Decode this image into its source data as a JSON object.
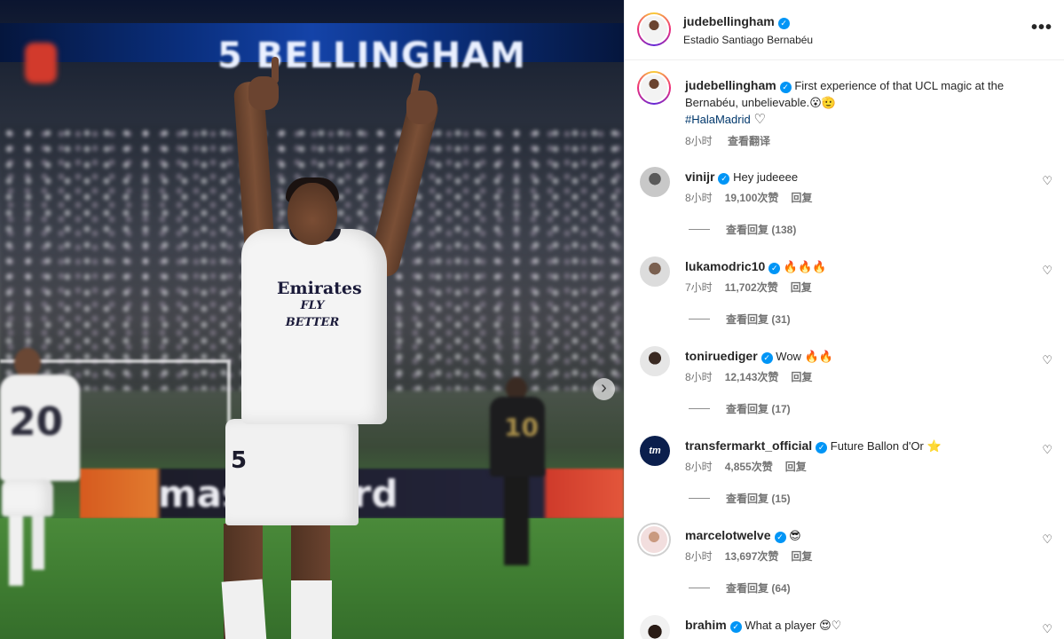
{
  "photo": {
    "banner_text": "5 BELLINGHAM",
    "shirt_sponsor_top": "Emirates",
    "shirt_sponsor_bottom": "FLY BETTER",
    "shorts_number": "5",
    "ad_board_text": "mastercard",
    "left_player_number": "20",
    "right_player_number": "10",
    "next_icon": "chevron-right-icon"
  },
  "header": {
    "username": "judebellingham",
    "location": "Estadio Santiago Bernabéu",
    "more_icon": "more-horizontal-icon",
    "more_label": "•••"
  },
  "caption": {
    "username": "judebellingham",
    "text": "First experience of that UCL magic at the Bernabéu, unbelievable.😮🫡",
    "hashtag": "#HalaMadrid",
    "heart": "♡",
    "time": "8小时",
    "translate": "查看翻译"
  },
  "comments": [
    {
      "username": "vinijr",
      "text": "Hey judeeee",
      "time": "8小时",
      "likes": "19,100次赞",
      "reply": "回复",
      "view_replies": "查看回复 (138)"
    },
    {
      "username": "lukamodric10",
      "text": "🔥🔥🔥",
      "time": "7小时",
      "likes": "11,702次赞",
      "reply": "回复",
      "view_replies": "查看回复 (31)"
    },
    {
      "username": "toniruediger",
      "text": "Wow 🔥🔥",
      "time": "8小时",
      "likes": "12,143次赞",
      "reply": "回复",
      "view_replies": "查看回复 (17)"
    },
    {
      "username": "transfermarkt_official",
      "text": "Future Ballon d'Or ⭐",
      "time": "8小时",
      "likes": "4,855次赞",
      "reply": "回复",
      "view_replies": "查看回复 (15)"
    },
    {
      "username": "marcelotwelve",
      "text": "😎",
      "time": "8小时",
      "likes": "13,697次赞",
      "reply": "回复",
      "view_replies": "查看回复 (64)"
    },
    {
      "username": "brahim",
      "text": "What a player 😍♡",
      "time": "",
      "likes": "",
      "reply": "",
      "view_replies": ""
    }
  ],
  "colors": {
    "link_blue": "#00376b",
    "verified_blue": "#0095f6",
    "meta_gray": "#737373"
  }
}
